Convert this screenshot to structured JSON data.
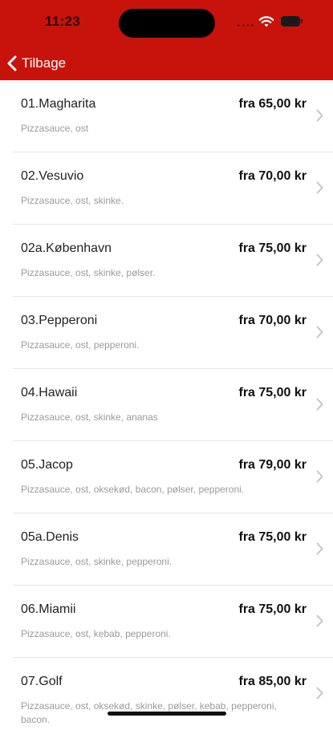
{
  "status": {
    "time": "11:23"
  },
  "nav": {
    "back_label": "Tilbage"
  },
  "items": [
    {
      "name": "01.Magharita",
      "price": "fra 65,00 kr",
      "desc": "Pizzasauce, ost"
    },
    {
      "name": "02.Vesuvio",
      "price": "fra 70,00 kr",
      "desc": "Pizzasauce, ost, skinke."
    },
    {
      "name": "02a.København",
      "price": "fra 75,00 kr",
      "desc": "Pizzasauce, ost, skinke, pølser."
    },
    {
      "name": "03.Pepperoni",
      "price": "fra 70,00 kr",
      "desc": "Pizzasauce, ost, pepperoni."
    },
    {
      "name": "04.Hawaii",
      "price": "fra 75,00 kr",
      "desc": "Pizzasauce, ost, skinke, ananas"
    },
    {
      "name": "05.Jacop",
      "price": "fra 79,00 kr",
      "desc": "Pizzasauce, ost, oksekød, bacon, pølser, pepperoni."
    },
    {
      "name": "05a.Denis",
      "price": "fra 75,00 kr",
      "desc": "Pizzasauce, ost, skinke, pepperoni."
    },
    {
      "name": "06.Miamii",
      "price": "fra 75,00 kr",
      "desc": "Pizzasauce, ost, kebab, pepperoni."
    },
    {
      "name": "07.Golf",
      "price": "fra 85,00 kr",
      "desc": "Pizzasauce, ost, oksekød, skinke, pølser, kebab, pepperoni, bacon."
    }
  ],
  "colors": {
    "accent": "#c8130c"
  },
  "icons": {
    "back": "chevron-left-icon",
    "row": "chevron-right-icon",
    "wifi": "wifi-icon",
    "battery": "battery-icon"
  }
}
